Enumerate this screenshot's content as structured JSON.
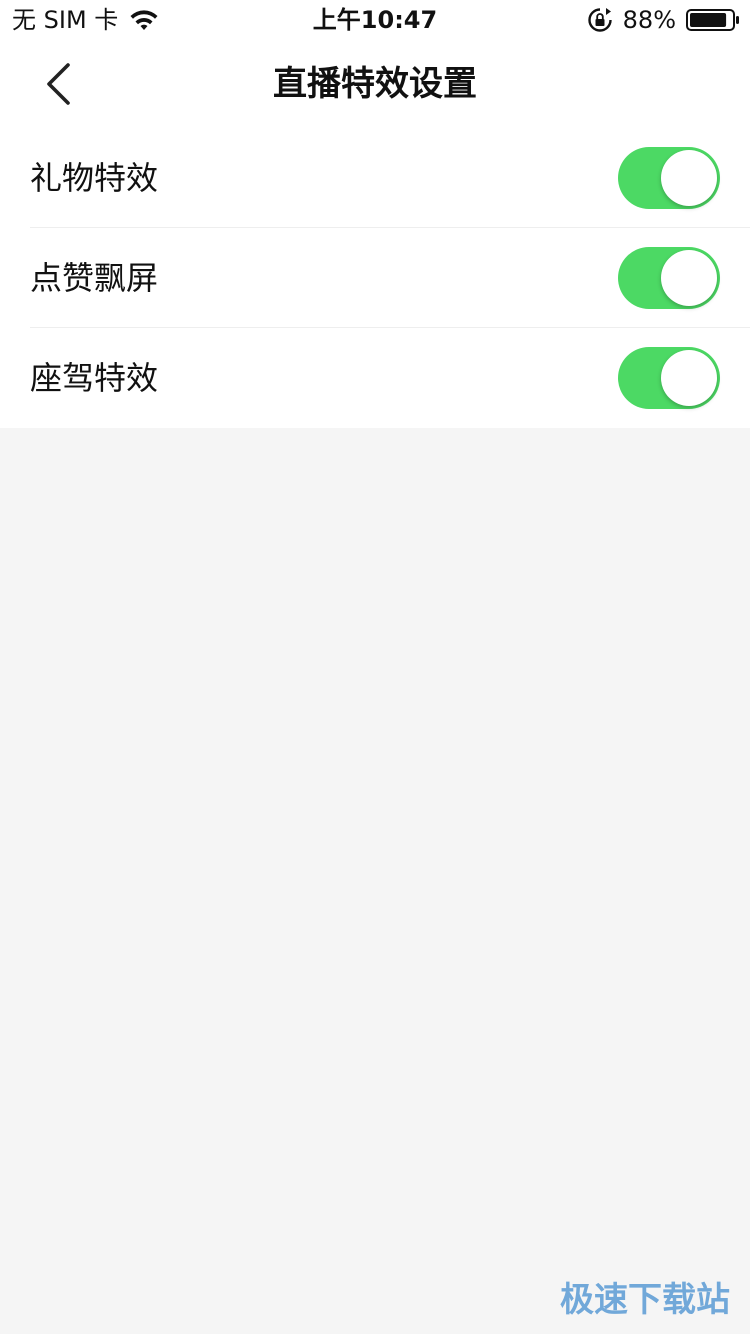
{
  "status_bar": {
    "carrier": "无 SIM 卡",
    "time": "上午10:47",
    "battery_percent": "88%",
    "battery_level": 0.88,
    "icons": [
      "wifi-icon",
      "lock-rotation-icon",
      "battery-icon"
    ]
  },
  "nav": {
    "title": "直播特效设置",
    "back_icon": "chevron-left-icon"
  },
  "settings": [
    {
      "label": "礼物特效",
      "enabled": true
    },
    {
      "label": "点赞飘屏",
      "enabled": true
    },
    {
      "label": "座驾特效",
      "enabled": true
    }
  ],
  "colors": {
    "toggle_on": "#4cd964",
    "background": "#f5f5f5",
    "watermark": "#5b9bd5"
  },
  "watermark": "极速下载站"
}
